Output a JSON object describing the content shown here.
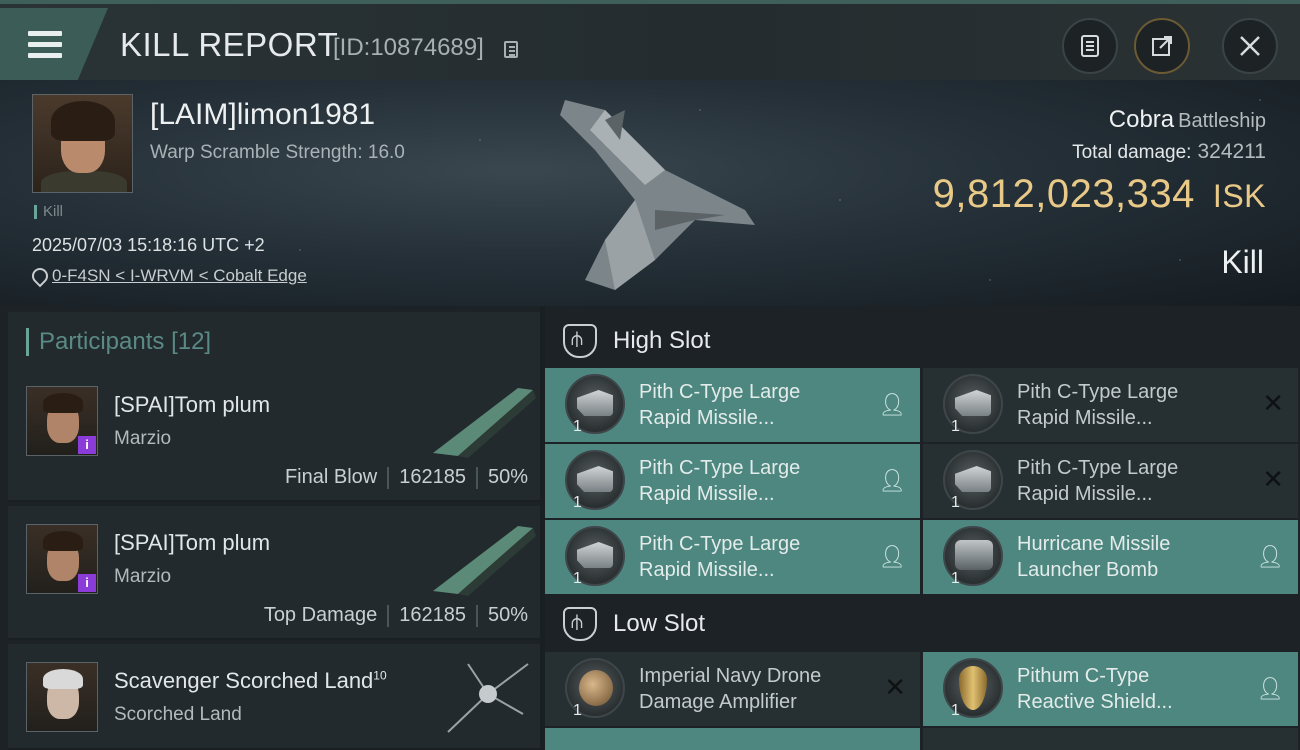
{
  "header": {
    "title": "KILL REPORT",
    "report_id": "[ID:10874689]"
  },
  "victim": {
    "name": "[LAIM]limon1981",
    "warp_scramble": "Warp Scramble Strength: 16.0",
    "kill_tag": "Kill",
    "timestamp": "2025/07/03 15:18:16 UTC +2",
    "location": "0-F4SN < I-WRVM < Cobalt Edge",
    "ship_name": "Cobra",
    "ship_class": "Battleship",
    "total_damage_label": "Total damage:",
    "total_damage": "324211",
    "isk_value": "9,812,023,334",
    "isk_unit": "ISK",
    "status": "Kill"
  },
  "participants": {
    "label": "Participants",
    "count": "[12]",
    "rows": [
      {
        "name": "[SPAI]Tom plum",
        "corp": "Marzio",
        "role": "Final Blow",
        "damage": "162185",
        "percent": "50%"
      },
      {
        "name": "[SPAI]Tom plum",
        "corp": "Marzio",
        "role": "Top Damage",
        "damage": "162185",
        "percent": "50%"
      },
      {
        "name": "Scavenger Scorched Land",
        "level": "10",
        "corp": "Scorched Land"
      }
    ]
  },
  "slots": {
    "high_label": "High Slot",
    "low_label": "Low Slot",
    "high_items": [
      {
        "line1": "Pith C-Type Large",
        "line2": "Rapid Missile...",
        "qty": "1",
        "state": "dropped"
      },
      {
        "line1": "Pith C-Type Large",
        "line2": "Rapid Missile...",
        "qty": "1",
        "state": "destroyed"
      },
      {
        "line1": "Pith C-Type Large",
        "line2": "Rapid Missile...",
        "qty": "1",
        "state": "dropped"
      },
      {
        "line1": "Pith C-Type Large",
        "line2": "Rapid Missile...",
        "qty": "1",
        "state": "destroyed"
      },
      {
        "line1": "Pith C-Type Large",
        "line2": "Rapid Missile...",
        "qty": "1",
        "state": "dropped"
      },
      {
        "line1": "Hurricane Missile",
        "line2": "Launcher Bomb",
        "qty": "1",
        "state": "dropped"
      }
    ],
    "low_items": [
      {
        "line1": "Imperial Navy Drone",
        "line2": "Damage Amplifier",
        "qty": "1",
        "state": "destroyed"
      },
      {
        "line1": "Pithum C-Type",
        "line2": "Reactive Shield...",
        "qty": "1",
        "state": "dropped"
      }
    ]
  },
  "icons": {
    "menu": "hamburger-icon",
    "copy": "copy-icon",
    "report": "clipboard-icon",
    "share": "share-icon",
    "close": "close-icon",
    "dropped": "person-icon",
    "destroyed": "x-icon"
  },
  "colors": {
    "accent": "#6aa59a",
    "isk": "#e9c987",
    "dropped_bg": "#4e8780",
    "destroyed_bg": "#263033"
  }
}
